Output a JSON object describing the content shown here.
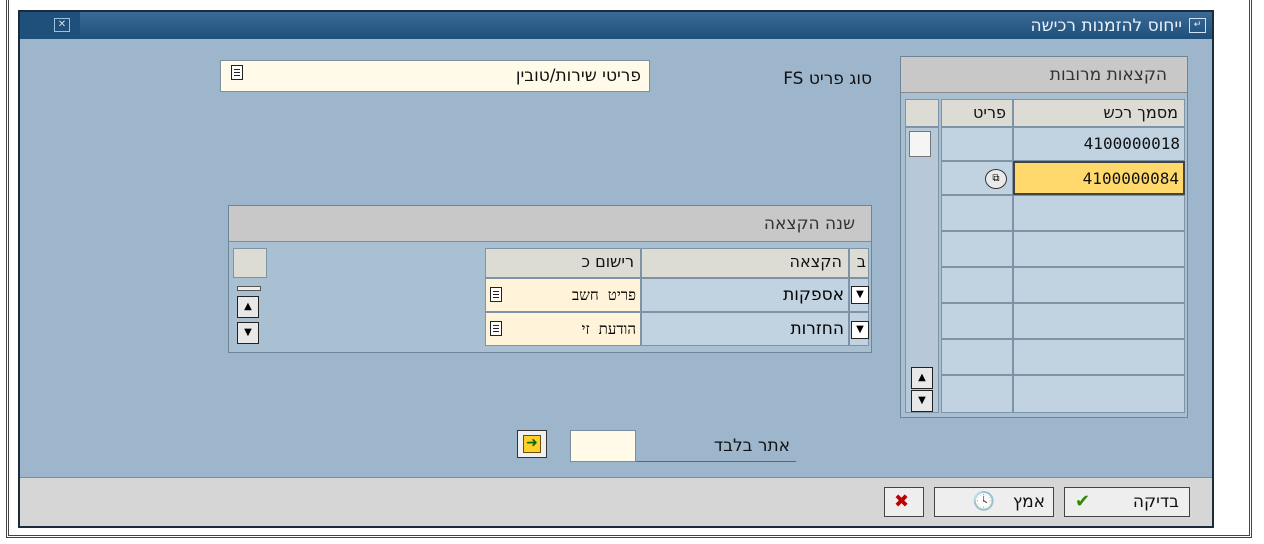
{
  "window": {
    "title": "ייחוס להזמנות רכישה"
  },
  "item_type": {
    "label": "סוג פריט FS",
    "value": "פריטי שירות/טובין"
  },
  "multiple_assignments": {
    "title": "הקצאות מרובות",
    "columns": [
      "מסמך רכש",
      "פריט"
    ],
    "rows": [
      {
        "doc": "4100000018",
        "item": ""
      },
      {
        "doc": "4100000084",
        "item": ""
      }
    ]
  },
  "allocation_year": {
    "title": "שנה הקצאה",
    "columns": [
      "ב",
      "הקצאה",
      "רישום כ"
    ],
    "rows": [
      {
        "allocation": "אספקות",
        "posting": "פריט חשב"
      },
      {
        "allocation": "החזרות",
        "posting": "הודעת זי"
      }
    ]
  },
  "site_only": {
    "label": "אתר בלבד",
    "value": ""
  },
  "buttons": {
    "check": "בדיקה",
    "accept": "אמץ"
  },
  "icons": {
    "check": "checkmark-icon",
    "accept": "clock-accept-icon",
    "cancel": "cancel-x-icon",
    "details": "details-icon",
    "execute": "arrow-right-icon"
  }
}
